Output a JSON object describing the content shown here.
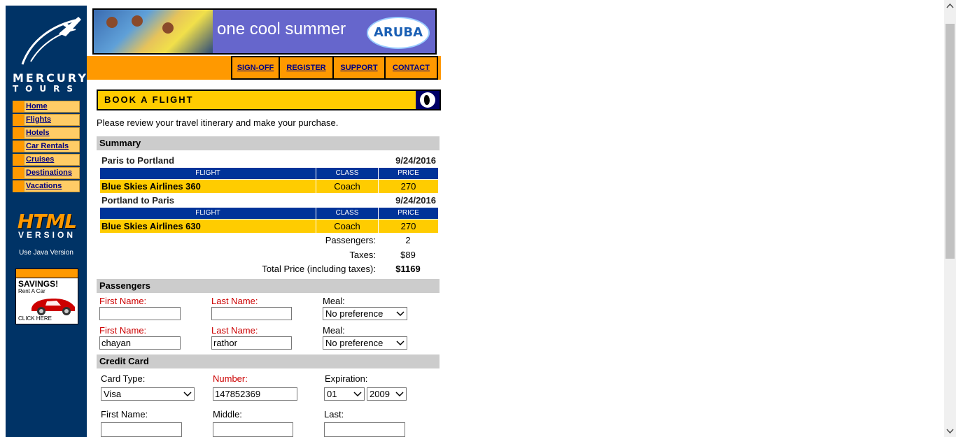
{
  "sidebar": {
    "brand_line1": "MERCURY",
    "brand_line2": "TOURS",
    "nav": [
      {
        "label": "Home"
      },
      {
        "label": "Flights"
      },
      {
        "label": "Hotels"
      },
      {
        "label": "Car Rentals"
      },
      {
        "label": "Cruises"
      },
      {
        "label": "Destinations"
      },
      {
        "label": "Vacations"
      }
    ],
    "html_version_big": "HTML",
    "html_version_sub": "VERSION",
    "java_link": "Use Java Version",
    "ad": {
      "savings": "SAVINGS!",
      "rent": "Rent A Car",
      "click": "CLICK HERE"
    }
  },
  "banner": {
    "slogan": "one cool summer",
    "logo": "ARUBA"
  },
  "topnav": {
    "signoff": "SIGN-OFF",
    "register": "REGISTER",
    "support": "SUPPORT",
    "contact": "CONTACT"
  },
  "page": {
    "header": "BOOK A FLIGHT",
    "intro": "Please review your travel itinerary and make your purchase."
  },
  "summary": {
    "title": "Summary",
    "headers": {
      "flight": "FLIGHT",
      "class": "CLASS",
      "price": "PRICE"
    },
    "legs": [
      {
        "route": "Paris to Portland",
        "date": "9/24/2016",
        "flight": "Blue Skies Airlines 360",
        "class": "Coach",
        "price": "270"
      },
      {
        "route": "Portland to Paris",
        "date": "9/24/2016",
        "flight": "Blue Skies Airlines 630",
        "class": "Coach",
        "price": "270"
      }
    ],
    "passengers_label": "Passengers:",
    "passengers_value": "2",
    "taxes_label": "Taxes:",
    "taxes_value": "$89",
    "total_label": "Total Price (including taxes):",
    "total_value": "$1169"
  },
  "passengers": {
    "title": "Passengers",
    "first_label": "First Name:",
    "last_label": "Last Name:",
    "meal_label": "Meal:",
    "rows": [
      {
        "first": "",
        "last": "",
        "meal": "No preference"
      },
      {
        "first": "chayan",
        "last": "rathor",
        "meal": "No preference"
      }
    ]
  },
  "credit_card": {
    "title": "Credit Card",
    "card_type_label": "Card Type:",
    "card_type_value": "Visa",
    "number_label": "Number:",
    "number_value": "147852369",
    "expiration_label": "Expiration:",
    "exp_month": "01",
    "exp_year": "2009",
    "first_label": "First Name:",
    "middle_label": "Middle:",
    "last_label": "Last:",
    "first_value": "",
    "middle_value": "",
    "last_value": ""
  },
  "colors": {
    "sidebar": "#003366",
    "accent_orange": "#ff9900",
    "header_yellow": "#ffcc00",
    "table_header_blue": "#003399",
    "required_red": "#cc0000"
  }
}
